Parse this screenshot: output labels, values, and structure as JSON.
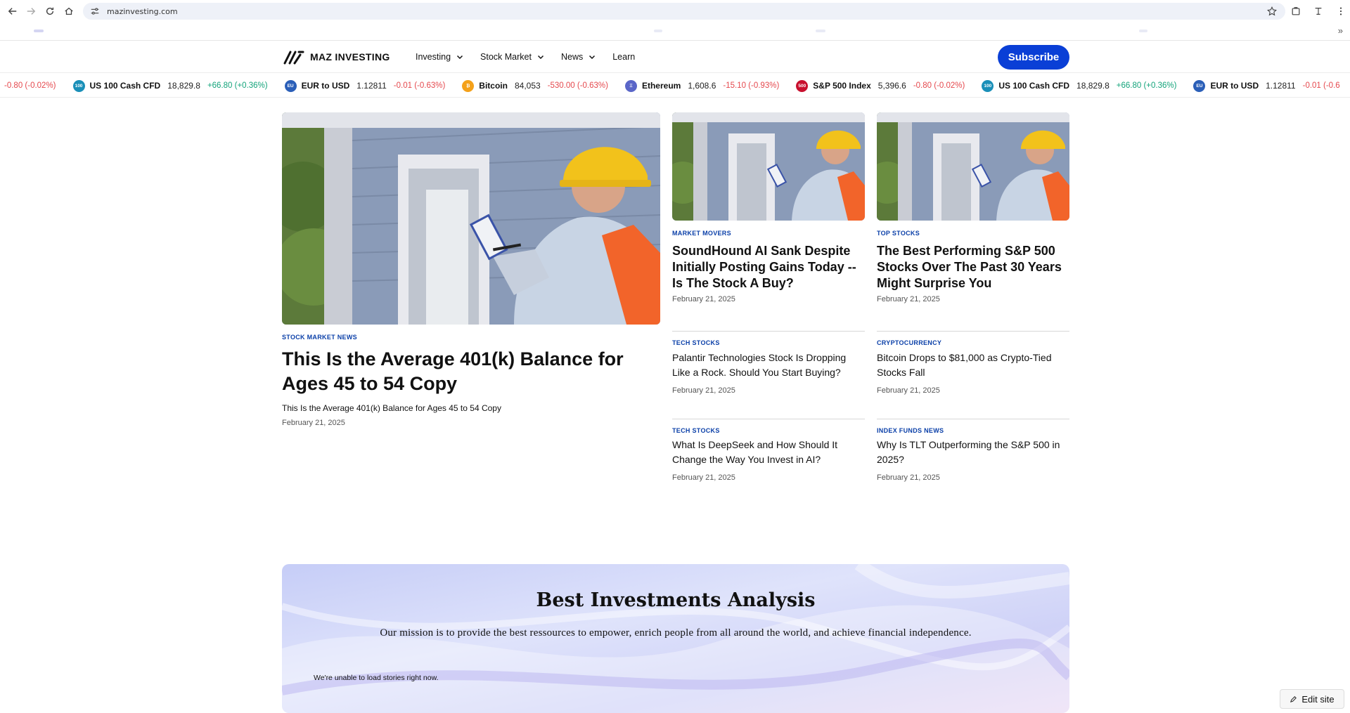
{
  "browser": {
    "url": "mazinvesting.com"
  },
  "header": {
    "logo_text": "MAZ INVESTING",
    "nav": [
      {
        "label": "Investing",
        "has_dropdown": true
      },
      {
        "label": "Stock Market",
        "has_dropdown": true
      },
      {
        "label": "News",
        "has_dropdown": true
      },
      {
        "label": "Learn",
        "has_dropdown": false
      }
    ],
    "subscribe_label": "Subscribe"
  },
  "ticker": {
    "leading_change": "-0.80 (-0.02%)",
    "items": [
      {
        "icon": "100",
        "icon_color": "#1a8fb8",
        "name": "US 100 Cash CFD",
        "price": "18,829.8",
        "change": "+66.80 (+0.36%)",
        "direction": "up"
      },
      {
        "icon": "EU",
        "icon_color": "#2b5fb8",
        "name": "EUR to USD",
        "price": "1.12811",
        "change": "-0.01 (-0.63%)",
        "direction": "down"
      },
      {
        "icon": "₿",
        "icon_color": "#f4a11a",
        "name": "Bitcoin",
        "price": "84,053",
        "change": "-530.00 (-0.63%)",
        "direction": "down"
      },
      {
        "icon": "Ξ",
        "icon_color": "#5a66c8",
        "name": "Ethereum",
        "price": "1,608.6",
        "change": "-15.10 (-0.93%)",
        "direction": "down"
      },
      {
        "icon": "500",
        "icon_color": "#c8102e",
        "name": "S&P 500 Index",
        "price": "5,396.6",
        "change": "-0.80 (-0.02%)",
        "direction": "down"
      },
      {
        "icon": "100",
        "icon_color": "#1a8fb8",
        "name": "US 100 Cash CFD",
        "price": "18,829.8",
        "change": "+66.80 (+0.36%)",
        "direction": "up"
      },
      {
        "icon": "EU",
        "icon_color": "#2b5fb8",
        "name": "EUR to USD",
        "price": "1.12811",
        "change": "-0.01 (-0.6",
        "direction": "down"
      }
    ]
  },
  "hero": {
    "category": "STOCK MARKET NEWS",
    "title": "This Is the Average 401(k) Balance for Ages 45 to 54 Copy",
    "subtitle": "This Is the Average 401(k) Balance for Ages 45 to 54 Copy",
    "date": "February 21, 2025"
  },
  "cards": [
    {
      "category": "MARKET MOVERS",
      "title": "SoundHound AI Sank Despite Initially Posting Gains Today -- Is The Stock A Buy?",
      "date": "February 21, 2025"
    },
    {
      "category": "TOP STOCKS",
      "title": "The Best Performing S&P 500 Stocks Over The Past 30 Years Might Surprise You",
      "date": "February 21, 2025"
    }
  ],
  "small_articles": [
    {
      "category": "TECH STOCKS",
      "title": "Palantir Technologies Stock Is Dropping Like a Rock. Should You Start Buying?",
      "date": "February 21, 2025"
    },
    {
      "category": "CRYPTOCURRENCY",
      "title": "Bitcoin Drops to $81,000 as Crypto-Tied Stocks Fall",
      "date": "February 21, 2025"
    },
    {
      "category": "TECH STOCKS",
      "title": "What Is DeepSeek and How Should It Change the Way You Invest in AI?",
      "date": "February 21, 2025"
    },
    {
      "category": "INDEX FUNDS NEWS",
      "title": "Why Is TLT Outperforming the S&P 500 in 2025?",
      "date": "February 21, 2025"
    }
  ],
  "mission": {
    "title": "Best Investments Analysis",
    "text": "Our mission is to provide the best ressources to empower, enrich people from all around the world, and achieve financial independence.",
    "error": "We're unable to load stories right now."
  },
  "edit_site_label": "Edit site"
}
